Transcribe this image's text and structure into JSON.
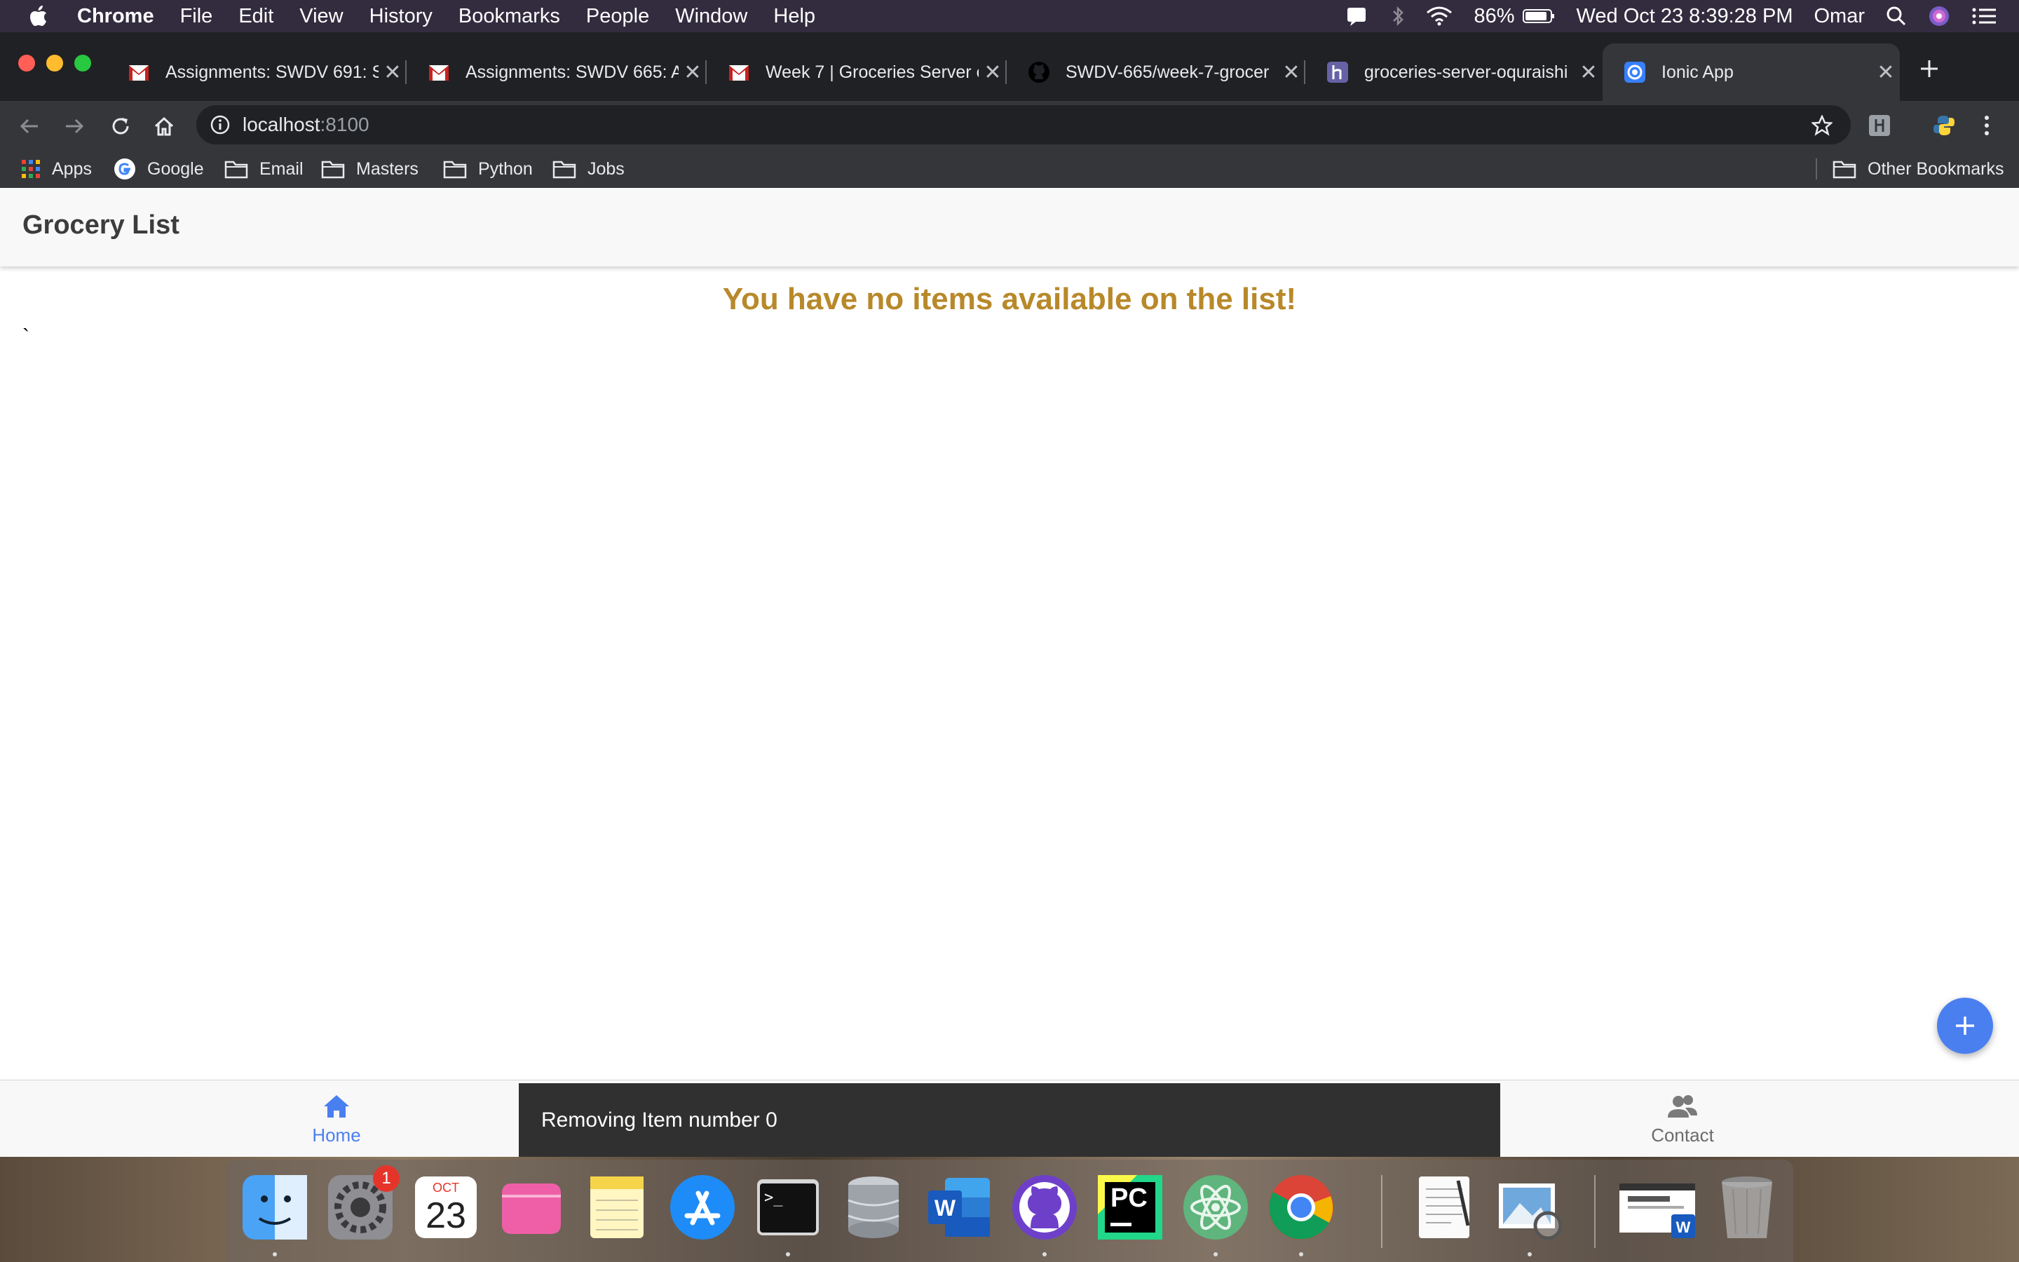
{
  "menubar": {
    "app": "Chrome",
    "items": [
      "File",
      "Edit",
      "View",
      "History",
      "Bookmarks",
      "People",
      "Window",
      "Help"
    ],
    "battery": "86%",
    "datetime": "Wed Oct 23  8:39:28 PM",
    "user": "Omar"
  },
  "tabs": [
    {
      "title": "Assignments: SWDV 691: S",
      "icon": "gmail-icon"
    },
    {
      "title": "Assignments: SWDV 665: A",
      "icon": "gmail-icon"
    },
    {
      "title": "Week 7 | Groceries Server o",
      "icon": "gmail-icon"
    },
    {
      "title": "SWDV-665/week-7-grocer",
      "icon": "github-icon"
    },
    {
      "title": "groceries-server-oquraishi",
      "icon": "heroku-icon"
    },
    {
      "title": "Ionic App",
      "icon": "ionic-icon"
    }
  ],
  "address": {
    "host": "localhost",
    "port": ":8100"
  },
  "bookmarks": {
    "items": [
      "Apps",
      "Google",
      "Email",
      "Masters",
      "Python",
      "Jobs"
    ],
    "other": "Other Bookmarks"
  },
  "app": {
    "title": "Grocery List",
    "empty_message": "You have no items available on the list!",
    "stray_char": "`",
    "tabs": {
      "home": "Home",
      "contact": "Contact"
    },
    "toast": "Removing Item number 0"
  },
  "dock": {
    "calendar_month": "OCT",
    "calendar_day": "23",
    "badge": "1",
    "terminal_prompt": ">_",
    "pycharm_label": "PC"
  },
  "colors": {
    "accent": "#4a7ff0",
    "empty_text": "#b8892a",
    "toast_bg": "#303030"
  }
}
